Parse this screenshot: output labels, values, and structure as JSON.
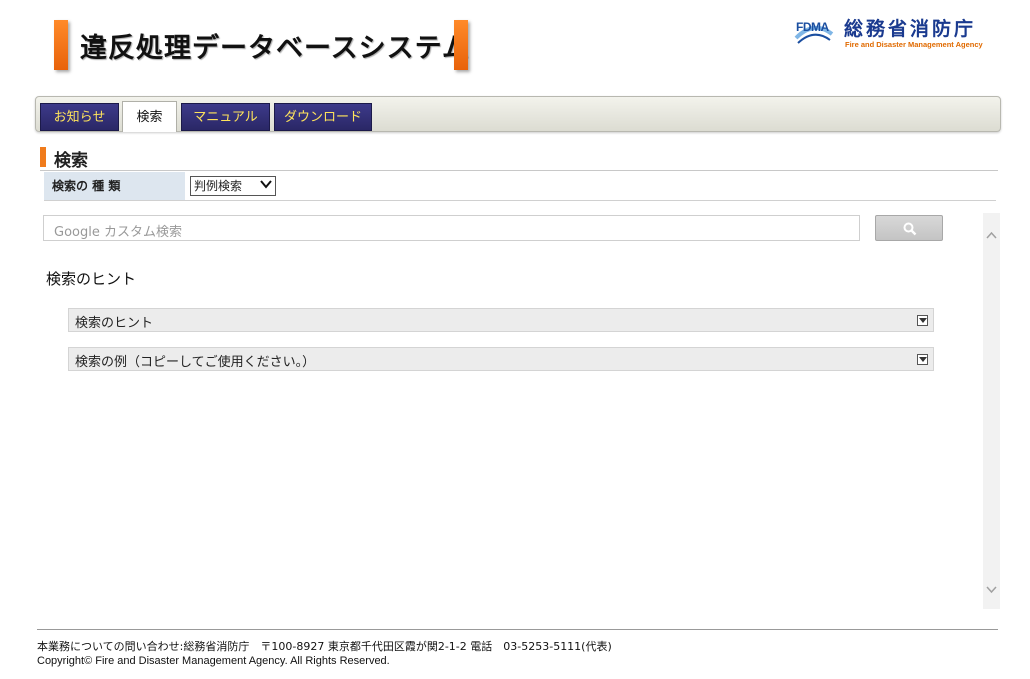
{
  "header": {
    "app_title": "違反処理データベースシステム",
    "agency_logo_text": "FDMA",
    "agency_name": "総務省消防庁",
    "agency_name_en": "Fire and Disaster Management Agency"
  },
  "tabs": [
    {
      "label": "お知らせ",
      "active": false
    },
    {
      "label": "検索",
      "active": true
    },
    {
      "label": "マニュアル",
      "active": false
    },
    {
      "label": "ダウンロード",
      "active": false
    }
  ],
  "section": {
    "title": "検索"
  },
  "search_type": {
    "label": "検索の 種 類",
    "selected": "判例検索",
    "chevron_icon": "chevron-down-icon"
  },
  "google_search": {
    "brand": "Google",
    "placeholder": "カスタム検索",
    "button_icon": "search-icon"
  },
  "hints": {
    "heading": "検索のヒント",
    "accordions": [
      {
        "label": "検索のヒント",
        "icon": "expand-icon"
      },
      {
        "label": "検索の例（コピーしてご使用ください。）",
        "icon": "expand-icon"
      }
    ]
  },
  "footer": {
    "contact": "本業務についての問い合わせ:総務省消防庁　〒100-8927 東京都千代田区霞が関2-1-2 電話　03-5253-5111(代表)",
    "copyright": "Copyright© Fire and Disaster Management Agency. All Rights Reserved."
  },
  "colors": {
    "accent_orange": "#f07b1c",
    "tab_dark": "#2f2c70",
    "tab_text": "#ffe45c",
    "agency_blue": "#1a3a8f"
  }
}
